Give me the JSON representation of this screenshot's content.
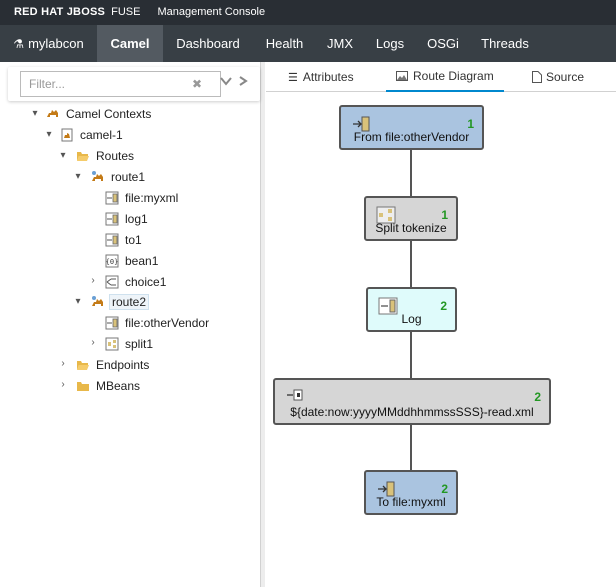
{
  "brand": {
    "company": "RED HAT JBOSS",
    "product": "FUSE",
    "console": "Management Console"
  },
  "nav": {
    "items": [
      {
        "label": "mylabcon",
        "active": false
      },
      {
        "label": "Camel",
        "active": true
      },
      {
        "label": "Dashboard",
        "active": false
      },
      {
        "label": "Health",
        "active": false
      },
      {
        "label": "JMX",
        "active": false
      },
      {
        "label": "Logs",
        "active": false
      },
      {
        "label": "OSGi",
        "active": false
      },
      {
        "label": "Threads",
        "active": false
      }
    ]
  },
  "filter": {
    "placeholder": "Filter...",
    "value": ""
  },
  "tree": {
    "camel_contexts": "Camel Contexts",
    "camel_1": "camel-1",
    "routes": "Routes",
    "route1": "route1",
    "file_myxml": "file:myxml",
    "log1": "log1",
    "to1": "to1",
    "bean1": "bean1",
    "choice1": "choice1",
    "route2": "route2",
    "file_otherVendor": "file:otherVendor",
    "split1": "split1",
    "endpoints": "Endpoints",
    "mbeans": "MBeans"
  },
  "tabs": [
    {
      "label": "Attributes",
      "icon": "list-icon"
    },
    {
      "label": "Route Diagram",
      "icon": "picture-icon"
    },
    {
      "label": "Source",
      "icon": "file-icon"
    }
  ],
  "diagram": {
    "nodes": [
      {
        "name": "From file:otherVendor",
        "count": "1"
      },
      {
        "name": "Split tokenize",
        "count": "1"
      },
      {
        "name": "Log",
        "count": "2"
      },
      {
        "name": "${date:now:yyyyMMddhhmmssSSS}-read.xml",
        "count": "2"
      },
      {
        "name": "To file:myxml",
        "count": "2"
      }
    ]
  },
  "colors": {
    "brand_bar": "#292e34",
    "nav_bar": "#383f45",
    "nav_active": "#535a61",
    "endpoint_node": "#aac4e0",
    "split_node": "#d6d6d6",
    "log_node": "#dffbfb",
    "exchange_count": "#239723",
    "tab_accent": "#0088ce"
  }
}
